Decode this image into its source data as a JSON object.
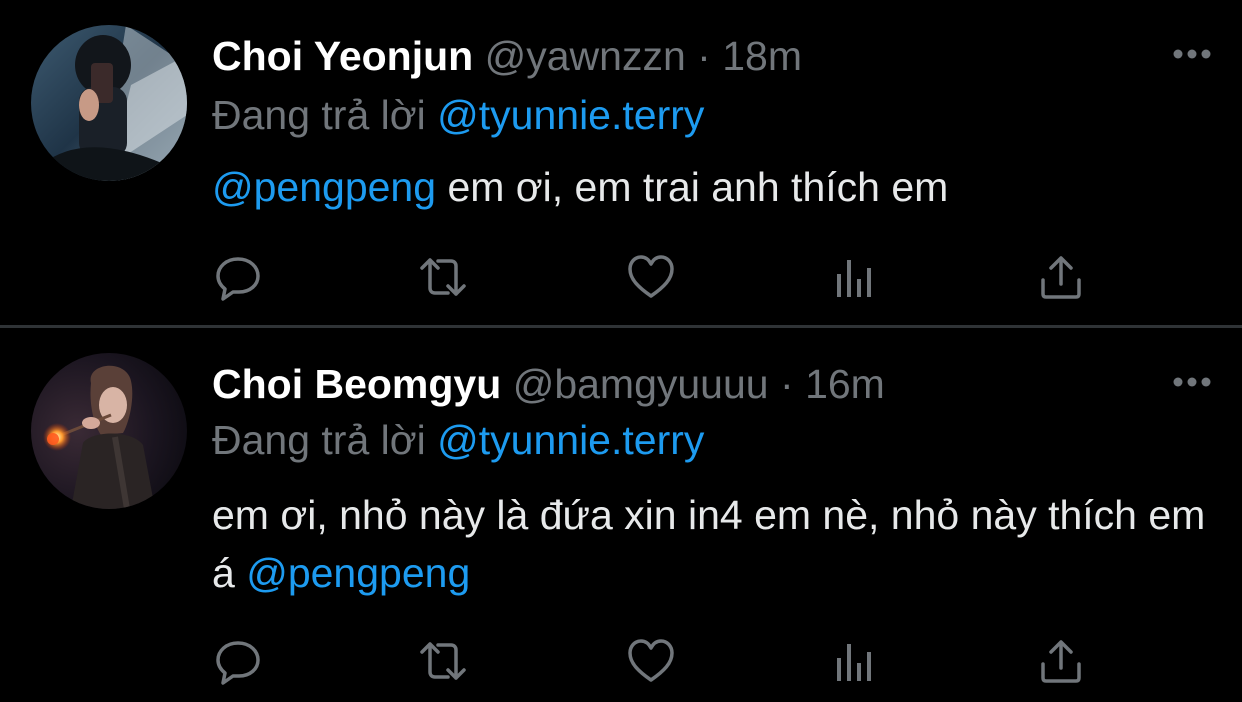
{
  "colors": {
    "background": "#000000",
    "name": "#ffffff",
    "secondary_text": "#71767b",
    "body_text": "#e7e9ea",
    "mention": "#1d9bf0",
    "divider": "#2f3336",
    "icon": "#71767b"
  },
  "tweets": [
    {
      "display_name": "Choi Yeonjun",
      "handle": "@yawnzzn",
      "separator": "·",
      "time": "18m",
      "reply_prefix": "Đang trả lời",
      "reply_to": "@tyunnie.terry",
      "body_mention": "@pengpeng",
      "body_text": " em ơi, em trai anh thích em",
      "avatar": "avatar-mirror-selfie",
      "actions": [
        "reply-icon",
        "retweet-icon",
        "like-icon",
        "analytics-icon",
        "share-icon"
      ]
    },
    {
      "display_name": "Choi Beomgyu",
      "handle": "@bamgyuuuu",
      "separator": "·",
      "time": "16m",
      "reply_prefix": "Đang trả lời",
      "reply_to": "@tyunnie.terry",
      "body_text": "em ơi, nhỏ này là đứa xin in4 em nè, nhỏ này thích em á ",
      "body_mention": "@pengpeng",
      "avatar": "avatar-flower-performance",
      "actions": [
        "reply-icon",
        "retweet-icon",
        "like-icon",
        "analytics-icon",
        "share-icon"
      ]
    }
  ]
}
